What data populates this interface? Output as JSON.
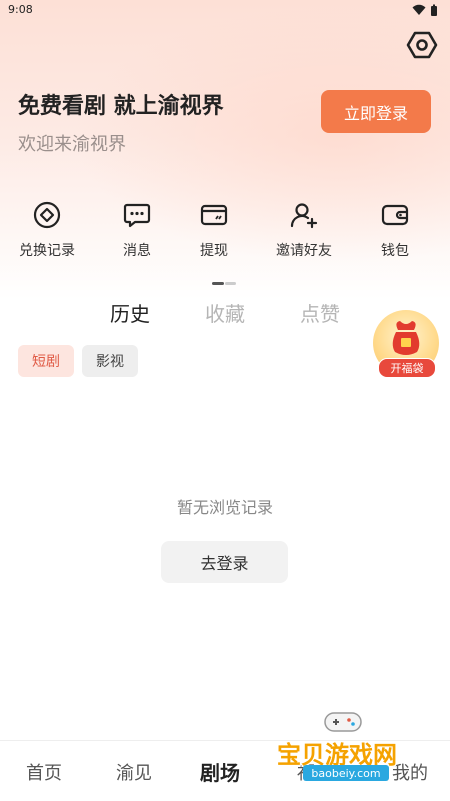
{
  "status_bar": {
    "time": "9:08"
  },
  "header": {
    "title": "免费看剧 就上渝视界",
    "subtitle": "欢迎来渝视界",
    "login_button": "立即登录"
  },
  "quick_actions": [
    {
      "label": "兑换记录",
      "icon": "coin-icon"
    },
    {
      "label": "消息",
      "icon": "message-icon"
    },
    {
      "label": "提现",
      "icon": "card-icon"
    },
    {
      "label": "邀请好友",
      "icon": "invite-user-icon"
    },
    {
      "label": "钱包",
      "icon": "wallet-icon"
    }
  ],
  "tabs": [
    {
      "label": "历史",
      "active": true
    },
    {
      "label": "收藏",
      "active": false
    },
    {
      "label": "点赞",
      "active": false
    }
  ],
  "chips": [
    {
      "label": "短剧",
      "active": true
    },
    {
      "label": "影视",
      "active": false
    }
  ],
  "lucky_bag": {
    "label": "开福袋"
  },
  "empty_state": {
    "message": "暂无浏览记录",
    "button": "去登录"
  },
  "bottom_nav": [
    {
      "label": "首页",
      "active": false
    },
    {
      "label": "渝见",
      "active": false
    },
    {
      "label": "剧场",
      "active": true
    },
    {
      "label": "福利",
      "active": false
    },
    {
      "label": "我的",
      "active": false
    }
  ],
  "watermark": {
    "title": "宝贝游戏网",
    "url": "baobeiy.com"
  },
  "colors": {
    "accent": "#f37a4a",
    "chip_active_text": "#e05a45",
    "watermark": "#f5a200"
  }
}
